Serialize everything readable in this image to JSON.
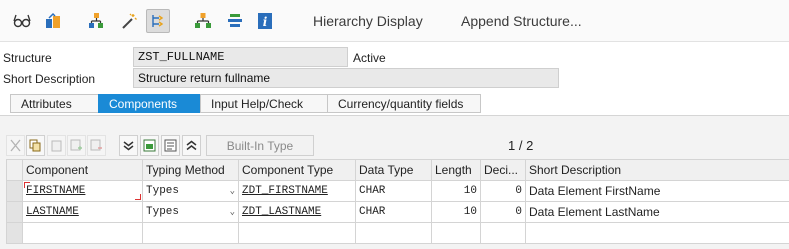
{
  "toolbar": {
    "icons": [
      "glasses-icon",
      "activate-icon",
      "hierarchy-icon",
      "wand-icon",
      "where-used-icon",
      "org-chart-icon",
      "stack-icon",
      "info-icon"
    ],
    "hierarchy_label": "Hierarchy Display",
    "append_label": "Append Structure..."
  },
  "header": {
    "structure_label": "Structure",
    "structure_value": "ZST_FULLNAME",
    "status": "Active",
    "short_desc_label": "Short Description",
    "short_desc_value": "Structure return fullname"
  },
  "tabs": [
    {
      "label": "Attributes",
      "active": false
    },
    {
      "label": "Components",
      "active": true
    },
    {
      "label": "Input Help/Check",
      "active": false
    },
    {
      "label": "Currency/quantity fields",
      "active": false
    }
  ],
  "components": {
    "builtin_label": "Built-In Type",
    "pager": "1 / 2",
    "columns": [
      "Component",
      "Typing Method",
      "Component Type",
      "Data Type",
      "Length",
      "Deci...",
      "Short Description"
    ],
    "rows": [
      {
        "component": "FIRSTNAME",
        "typing": "Types",
        "type": "ZDT_FIRSTNAME",
        "datatype": "CHAR",
        "length": "10",
        "deci": "0",
        "desc": "Data Element FirstName"
      },
      {
        "component": "LASTNAME",
        "typing": "Types",
        "type": "ZDT_LASTNAME",
        "datatype": "CHAR",
        "length": "10",
        "deci": "0",
        "desc": "Data Element LastName"
      }
    ]
  }
}
